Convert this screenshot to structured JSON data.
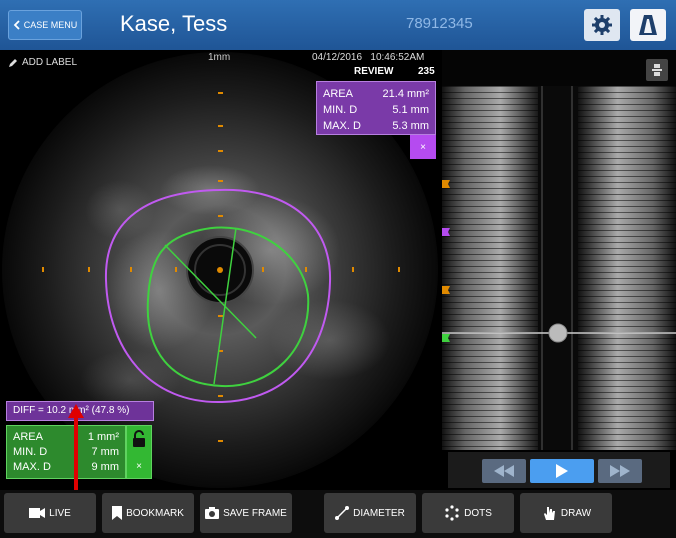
{
  "header": {
    "case_menu": "CASE MENU",
    "patient_name": "Kase, Tess",
    "patient_id": "78912345"
  },
  "ivus": {
    "add_label": "ADD LABEL",
    "scale": "1mm",
    "date": "04/12/2016",
    "time": "10:46:52AM",
    "mode": "REVIEW",
    "frame": "235"
  },
  "purple_measure": {
    "area_label": "AREA",
    "area_value": "21.4 mm²",
    "mind_label": "MIN. D",
    "mind_value": "5.1 mm",
    "maxd_label": "MAX. D",
    "maxd_value": "5.3 mm",
    "close": "×"
  },
  "diff": {
    "text": "DIFF = 10.2 mm² (47.8 %)"
  },
  "green_measure": {
    "area_label": "AREA",
    "area_value": "1 mm²",
    "mind_label": "MIN. D",
    "mind_value": "7 mm",
    "maxd_label": "MAX. D",
    "maxd_value": "9 mm",
    "close": "×"
  },
  "toolbar": {
    "live": "LIVE",
    "bookmark": "BOOKMARK",
    "save_frame": "SAVE FRAME",
    "diameter": "DIAMETER",
    "dots": "DOTS",
    "draw": "DRAW"
  },
  "colors": {
    "header": "#2f6fb3",
    "purple": "#b54bf0",
    "green": "#3fd13f",
    "arrow": "#e00000",
    "orange": "#e08a00"
  },
  "icons": [
    "chevron-left-icon",
    "gear-icon",
    "logo-icon",
    "pencil-icon",
    "lock-open-icon",
    "close-icon",
    "rewind-icon",
    "play-icon",
    "fast-forward-icon",
    "video-camera-icon",
    "bookmark-icon",
    "camera-icon",
    "diameter-icon",
    "dots-icon",
    "hand-draw-icon",
    "expand-icon"
  ]
}
